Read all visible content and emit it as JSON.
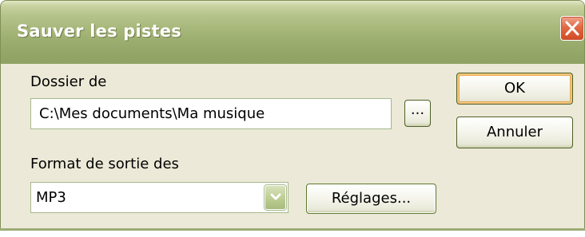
{
  "window": {
    "title": "Sauver les pistes"
  },
  "folder": {
    "label": "Dossier de",
    "value": "C:\\Mes documents\\Ma musique",
    "browse_label": "..."
  },
  "format": {
    "label": "Format de sortie des",
    "selected": "MP3",
    "settings_label": "Réglages..."
  },
  "buttons": {
    "ok_label": "OK",
    "cancel_label": "Annuler"
  },
  "icons": {
    "close": "close-icon",
    "dropdown": "chevron-down-icon"
  },
  "colors": {
    "titlebar": "#a7b77a",
    "close_button": "#d24a24",
    "dialog_background": "#ece9d8",
    "default_button_focus": "#eaa84d"
  }
}
